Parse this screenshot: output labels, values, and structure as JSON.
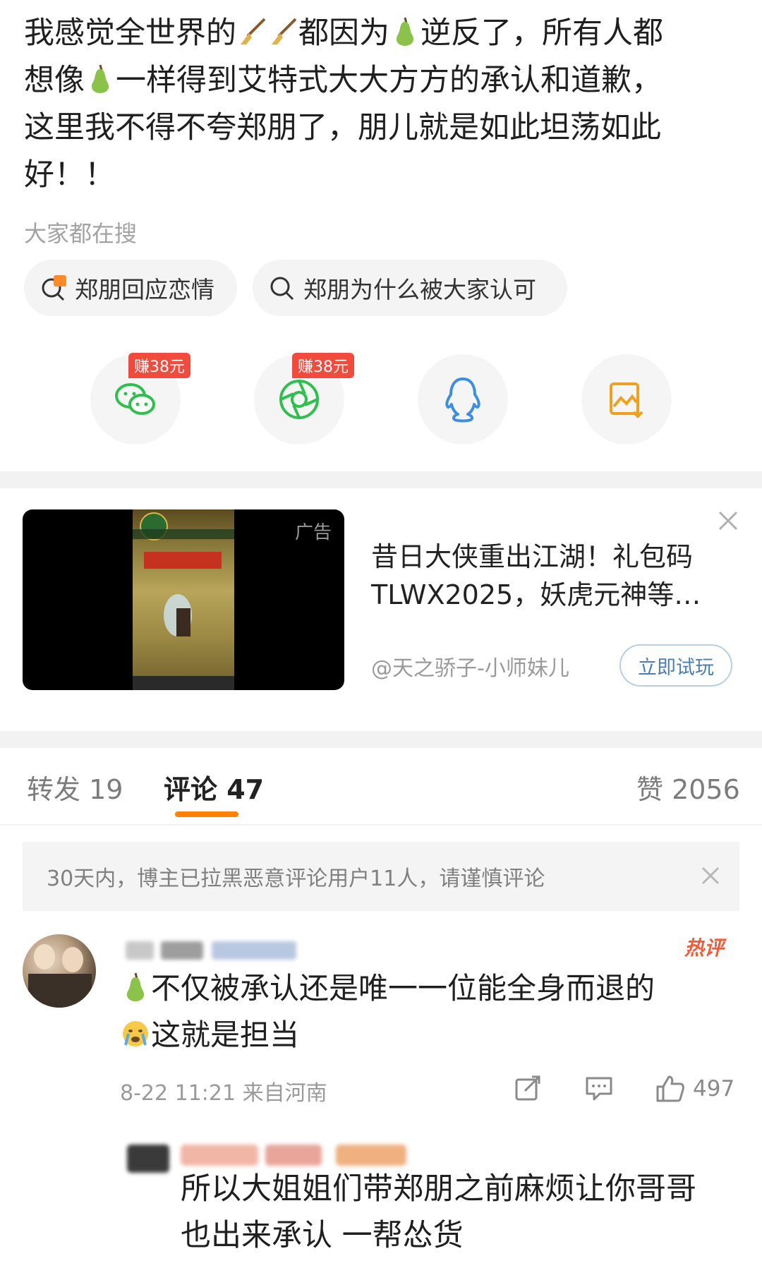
{
  "post": {
    "line1_a": "我感觉全世界的",
    "line1_b": "都因为",
    "line1_c": "逆反了，所有人都",
    "line2_a": "想像",
    "line2_b": "一样得到艾特式大大方方的承认和道歉，",
    "line3": "这里我不得不夸郑朋了，朋儿就是如此坦荡如此",
    "line4": "好！！"
  },
  "search": {
    "label": "大家都在搜",
    "chips": [
      "郑朋回应恋情",
      "郑朋为什么被大家认可"
    ]
  },
  "share": {
    "badges": [
      "赚38元",
      "赚38元"
    ],
    "icons": [
      "wechat-icon",
      "moments-icon",
      "qq-icon",
      "save-image-icon"
    ]
  },
  "ad": {
    "tag": "广告",
    "title": "昔日大侠重出江湖！礼包码TLWX2025，妖虎元神等…",
    "author": "@天之骄子-小师妹儿",
    "cta": "立即试玩"
  },
  "tabs": {
    "repost": "转发 19",
    "comments": "评论 47",
    "likes": "赞 2056"
  },
  "notice": {
    "text": "30天内，博主已拉黑恶意评论用户11人，请谨慎评论"
  },
  "comment": {
    "hot_tag": "热评",
    "text_a": "不仅被承认还是唯一一位能全身而退的",
    "text_b": "这就是担当",
    "time_location": "8-22 11:21 来自河南",
    "like_count": "497"
  },
  "reply": {
    "line1": "所以大姐姐们带郑朋之前麻烦让你哥哥",
    "line2": "也出来承认 一帮怂货"
  },
  "colors": {
    "accent_orange": "#ff8200",
    "hot_red": "#f55a3b",
    "wechat_green": "#2fbf4f",
    "qq_blue": "#3c8de3",
    "save_orange": "#f0a020"
  }
}
